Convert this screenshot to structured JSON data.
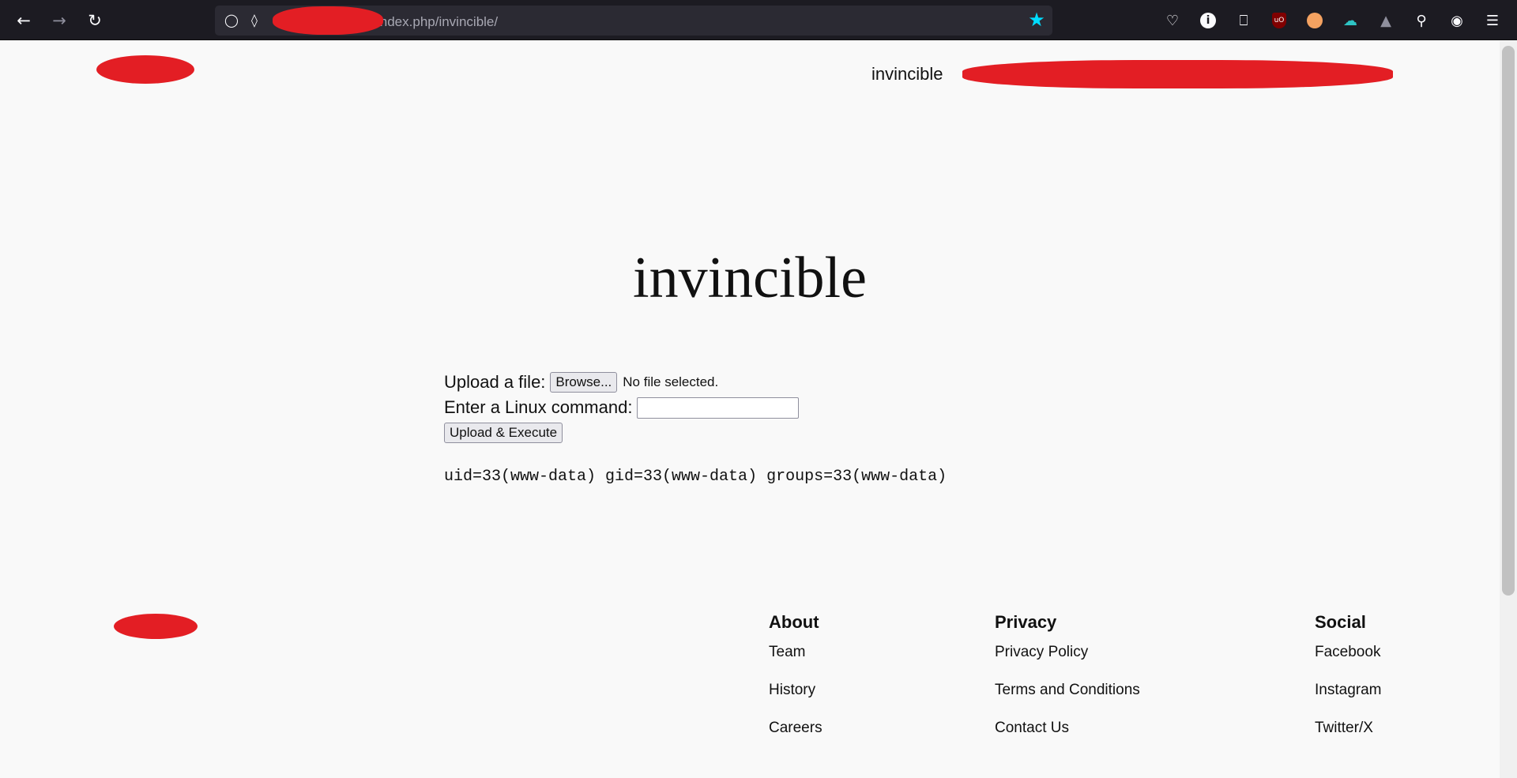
{
  "browser": {
    "url_visible": "index.php/invincible/",
    "back_icon": "arrow-left-icon",
    "forward_icon": "arrow-right-icon",
    "reload_icon": "reload-icon",
    "bookmark_color": "#00ddff"
  },
  "site": {
    "nav_item": "invincible"
  },
  "main": {
    "title": "invincible",
    "upload_label": "Upload a file:",
    "browse_label": "Browse...",
    "file_status": "No file selected.",
    "command_label": "Enter a Linux command:",
    "command_value": "",
    "submit_label": "Upload & Execute",
    "output": "uid=33(www-data) gid=33(www-data) groups=33(www-data)"
  },
  "footer": {
    "columns": [
      {
        "heading": "About",
        "links": [
          "Team",
          "History",
          "Careers"
        ]
      },
      {
        "heading": "Privacy",
        "links": [
          "Privacy Policy",
          "Terms and Conditions",
          "Contact Us"
        ]
      },
      {
        "heading": "Social",
        "links": [
          "Facebook",
          "Instagram",
          "Twitter/X"
        ]
      }
    ]
  }
}
